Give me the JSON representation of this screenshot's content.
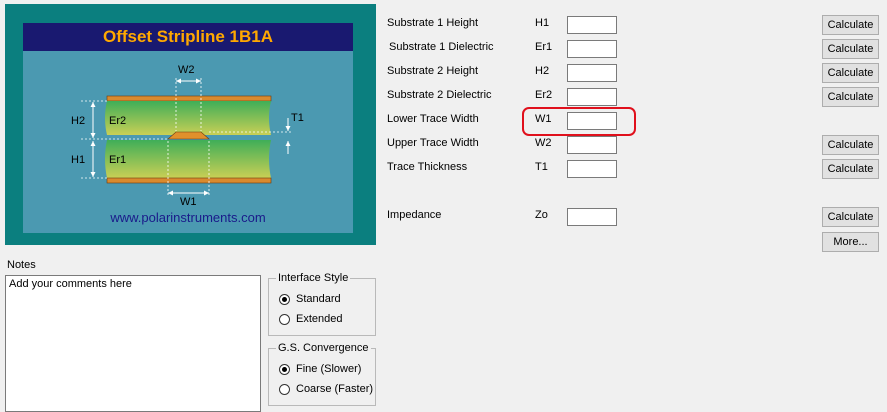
{
  "diagram": {
    "title": "Offset Stripline 1B1A",
    "url": "www.polarinstruments.com",
    "labels": {
      "w2": "W2",
      "w1": "W1",
      "h2": "H2",
      "h1": "H1",
      "er2": "Er2",
      "er1": "Er1",
      "t1": "T1"
    }
  },
  "form": {
    "rows": [
      {
        "label": "Substrate 1 Height",
        "symbol": "H1",
        "value": "",
        "button": "Calculate"
      },
      {
        "label": "Substrate 1 Dielectric",
        "symbol": "Er1",
        "value": "",
        "button": "Calculate"
      },
      {
        "label": "Substrate 2 Height",
        "symbol": "H2",
        "value": "",
        "button": "Calculate"
      },
      {
        "label": "Substrate 2 Dielectric",
        "symbol": "Er2",
        "value": "",
        "button": "Calculate"
      },
      {
        "label": "Lower Trace Width",
        "symbol": "W1",
        "value": ""
      },
      {
        "label": "Upper Trace Width",
        "symbol": "W2",
        "value": "",
        "button": "Calculate"
      },
      {
        "label": "Trace Thickness",
        "symbol": "T1",
        "value": "",
        "button": "Calculate"
      }
    ],
    "impedance": {
      "label": "Impedance",
      "symbol": "Zo",
      "value": "",
      "button": "Calculate"
    },
    "more_button": "More...",
    "highlight_color": "#e0101c"
  },
  "notes": {
    "label": "Notes",
    "text": "Add your comments here"
  },
  "interface_style": {
    "title": "Interface Style",
    "options": [
      "Standard",
      "Extended"
    ],
    "selected": "Standard"
  },
  "convergence": {
    "title": "G.S. Convergence",
    "options": [
      "Fine (Slower)",
      "Coarse (Faster)"
    ],
    "selected": "Fine (Slower)"
  }
}
